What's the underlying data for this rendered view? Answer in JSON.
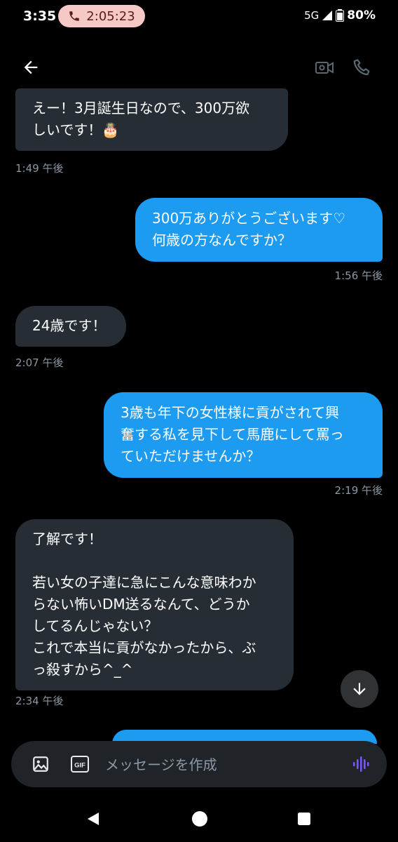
{
  "status_bar": {
    "time": "3:35",
    "call_timer": "2:05:23",
    "network": "5G",
    "battery": "80%"
  },
  "header": {
    "back_icon": "arrow-left-icon",
    "video_icon": "video-camera-icon",
    "phone_icon": "phone-icon"
  },
  "messages": [
    {
      "dir": "in",
      "text": "えー！3月誕生日なので、300万欲\nしいです！🎂",
      "time": "1:49 午後"
    },
    {
      "dir": "out",
      "text": "300万ありがとうございます♡\n何歳の方なんですか？",
      "time": "1:56 午後"
    },
    {
      "dir": "in",
      "text": "24歳です！",
      "time": "2:07 午後"
    },
    {
      "dir": "out",
      "text": "3歳も年下の女性様に貢がされて興\n奮する私を見下して馬鹿にして罵っ\nていただけませんか？",
      "time": "2:19 午後"
    },
    {
      "dir": "in",
      "text": "了解です！\n\n若い女の子達に急にこんな意味わか\nらない怖いDM送るなんて、どうか\nしてるんじゃない？\nこれで本当に貢がなかったから、ぶ\nっ殺すから^_^",
      "time": "2:34 午後"
    }
  ],
  "composer": {
    "placeholder": "メッセージを作成",
    "gif_label": "GIF"
  },
  "colors": {
    "outgoing": "#1d9bf0",
    "incoming": "#262d34",
    "accent_voice": "#7856ff"
  }
}
